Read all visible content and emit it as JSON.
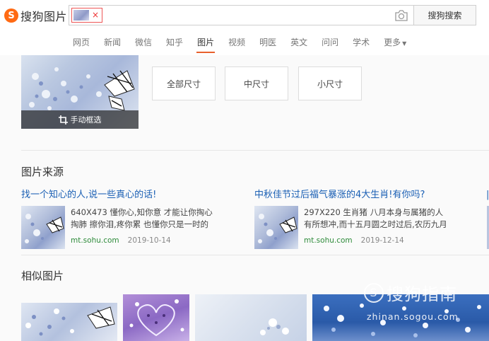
{
  "header": {
    "logo_text": "搜狗图片",
    "logo_mark": "S",
    "chip_close": "×",
    "search_button": "搜狗搜索",
    "nav": [
      {
        "label": "网页"
      },
      {
        "label": "新闻"
      },
      {
        "label": "微信"
      },
      {
        "label": "知乎"
      },
      {
        "label": "图片",
        "active": true
      },
      {
        "label": "视频"
      },
      {
        "label": "明医"
      },
      {
        "label": "英文"
      },
      {
        "label": "问问"
      },
      {
        "label": "学术"
      },
      {
        "label": "更多"
      }
    ]
  },
  "preview": {
    "crop_label": "手动框选"
  },
  "size_filters": [
    "全部尺寸",
    "中尺寸",
    "小尺寸"
  ],
  "sources": {
    "title": "图片来源",
    "items": [
      {
        "title": "找一个知心的人,说一些真心的话!",
        "line1": "640X473 懂你心,知你意 才能让你掏心",
        "line2": "掏肺 擦你泪,疼你累 也懂你只是一时的",
        "domain": "mt.sohu.com",
        "date": "2019-10-14"
      },
      {
        "title": "中秋佳节过后福气暴涨的4大生肖!有你吗?",
        "line1": "297X220 生肖猪 八月本身与属猪的人",
        "line2": "有所想冲,而十五月圆之时过后,农历九月",
        "domain": "mt.sohu.com",
        "date": "2019-12-14"
      }
    ]
  },
  "similar": {
    "title": "相似图片"
  },
  "watermark": {
    "mark": "S",
    "text": "搜狗指南",
    "url": "zhinan.sogou.com"
  },
  "colors": {
    "brand": "#ff6a13",
    "link": "#1a5fb4",
    "domain": "#2e8b3a",
    "active_tab": "#e8602c"
  }
}
